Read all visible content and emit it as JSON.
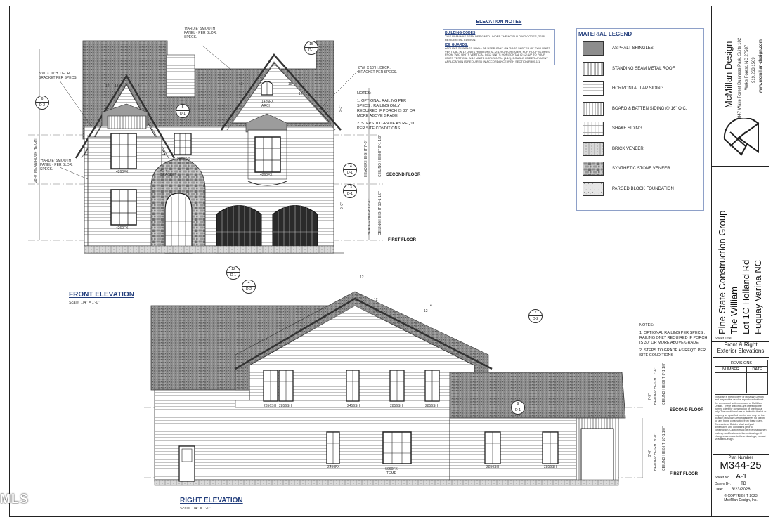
{
  "notes_panel": {
    "title": "ELEVATION NOTES",
    "building_codes_title": "BUILDING CODES",
    "building_codes_text": "THIS PLAN HAS BEEN DESIGNED UNDER THE NC BUILDING CODES, 2018 RESIDENTIAL EDITION.",
    "ice_guards_title": "ICE GUARDS:",
    "ice_guards_text": "ASPHALT SHINGLES SHALL BE USED ONLY ON ROOF SLOPES OF TWO UNITS VERTICAL IN 12 UNITS HORIZONTAL (2:12) OR GREATER. FOR ROOF SLOPES FROM TWO UNITS VERTICAL IN 12 UNITS HORIZONTAL (2:12) UP TO FOUR UNITS VERTICAL IN 12 UNITS HORIZONTAL (4:12), DOUBLE UNDERLAYMENT APPLICATION IS REQUIRED IN ACCORDANCE WITH SECTION R905.1.1."
  },
  "legend": {
    "title": "MATERIAL LEGEND",
    "items": [
      {
        "label": "ASPHALT SHINGLES"
      },
      {
        "label": "STANDING SEAM METAL ROOF"
      },
      {
        "label": "HORIZONTAL LAP SIDING"
      },
      {
        "label": "BOARD & BATTEN SIDING @ 16\" O.C."
      },
      {
        "label": "SHAKE SIDING"
      },
      {
        "label": "BRICK VENEER"
      },
      {
        "label": "SYNTHETIC STONE VENEER"
      },
      {
        "label": "PARGED BLOCK FOUNDATION"
      }
    ]
  },
  "firm": {
    "name": "McMillan Design",
    "address1": "847 Wake Forest Business Park, Suite 102",
    "address2": "Wake Forest, NC 27587",
    "phone": "919.263.1509",
    "web": "www.mcmillan-design.com"
  },
  "project": {
    "client": "Pine State Construction Group",
    "plan_name": "The William",
    "lot": "Lot 1C Holland Rd",
    "city": "Fuquay Varina NC"
  },
  "sheet": {
    "sheet_title_label": "Sheet Title:",
    "sheet_title_1": "Front & Right",
    "sheet_title_2": "Exterior Elevations",
    "revisions_label": "REVISIONS",
    "number_label": "NUMBER",
    "date_label": "DATE",
    "disclaimer": "This plan is the property of McMillan Design and may not be used or reproduced without the expressed written consent of McMillan Design. These drawings are offered to the named client for construction of one house only. The conditional use is limited to the lot or property as specified herein, and only for the location McMillan Design assumes no liability for any home constructed from these plans. Contractor or Builder shall verify all dimensions and conditions prior to construction. Caution must be exercised when making modifications to these drawings. If changes are made to these drawings, contact McMillan Design.",
    "plan_number_label": "Plan Number",
    "plan_number": "M344-25",
    "sheet_no_label": "Sheet No.",
    "sheet_no": "A-1",
    "drawn_by_label": "Drawn By:",
    "drawn_by": "TB",
    "date_label2": "Date:",
    "date": "3/23/2026",
    "copyright1": "© COPYRIGHT 2023",
    "copyright2": "McMillan Design, Inc."
  },
  "front_elevation": {
    "title": "FRONT ELEVATION",
    "scale": "Scale: 1/4\" = 1'-0\"",
    "notes": [
      "NOTES:",
      "1. OPTIONAL RAILING PER SPECS . RAILING ONLY REQUIRED IF PORCH IS 30\" OR MORE ABOVE GRADE.",
      "2. STEPS TO GRADE AS REQ'D PER SITE CONDITIONS"
    ],
    "callouts": {
      "hardie_top": "'HARDIE' SMOOTH PANEL - PER BLDR. SPECS.",
      "bracket_left": "8\"W. X 10\"H. DECR. BRACKET PER SPECS.",
      "bracket_right": "8\"W. X 10\"H. DECR. BRACKET PER SPECS.",
      "hardie_left": "'HARDIE' SMOOTH PANEL - PER BLDR. SPECS.",
      "arch": "1426FX ARCH",
      "win_4260_upper": "4260FX",
      "win_4260_lower": "4260FX",
      "win_2860": "2860SC",
      "win_4260_right": "4260FX",
      "bracket_4_12": "4:12 BRACKET",
      "mean_roof": "28'-0\" MEAN ROOF HEIGHT",
      "header_upper": "HEADER HEIGHT 7'-6\"",
      "ceiling_upper": "CEILING HEIGHT 8'-1 1/8\"",
      "header_lower": "HEADER HEIGHT 8'-0\"",
      "ceiling_lower": "CEILING HEIGHT 10'-1 1/8\"",
      "dim_upper": "8'-3\"",
      "dim_lower": "9'-0\""
    },
    "levels": {
      "second": "SECOND FLOOR",
      "first": "FIRST FLOOR"
    },
    "tags": [
      {
        "n": "15",
        "s": "D-1"
      },
      {
        "n": "6",
        "s": "D-2"
      },
      {
        "n": "5",
        "s": "D-1"
      },
      {
        "n": "14",
        "s": "D-1"
      },
      {
        "n": "13",
        "s": "D-1"
      },
      {
        "n": "12",
        "s": "D-1"
      },
      {
        "n": "4",
        "s": "D-2"
      }
    ],
    "pitches": [
      "12",
      "18",
      "12",
      "12",
      "18",
      "12"
    ]
  },
  "right_elevation": {
    "title": "RIGHT ELEVATION",
    "scale": "Scale: 1/4\" = 1'-0\"",
    "notes": [
      "NOTES:",
      "1. OPTIONAL RAILING PER SPECS . RAILING ONLY REQUIRED IF PORCH IS 30\" OR MORE ABOVE GRADE.",
      "2. STEPS TO GRADE AS REQ'D PER SITE CONDITIONS"
    ],
    "windows_upper": [
      "2856SH",
      "2856SH",
      "2456SH",
      "2856SH",
      "2856SH"
    ],
    "windows_lower": [
      "2456FX",
      "5060FX TEMP",
      "2856SH",
      "2856SH"
    ],
    "levels": {
      "second": "SECOND FLOOR",
      "first": "FIRST FLOOR"
    },
    "dims": {
      "upper": "7'-9\"",
      "upper_header": "HEADER HEIGHT 7'-6\"",
      "upper_ceiling": "CEILING HEIGHT 8'-1 1/8\"",
      "lower": "9'-0\"",
      "lower_header": "HEADER HEIGHT 8'-0\"",
      "lower_ceiling": "CEILING HEIGHT 10'-1 1/8\""
    },
    "tags": [
      {
        "n": "2",
        "s": "D-2"
      },
      {
        "n": "9",
        "s": "D-1"
      }
    ],
    "pitches": [
      "12",
      "12",
      "4",
      "12"
    ]
  },
  "watermark": "MLS"
}
